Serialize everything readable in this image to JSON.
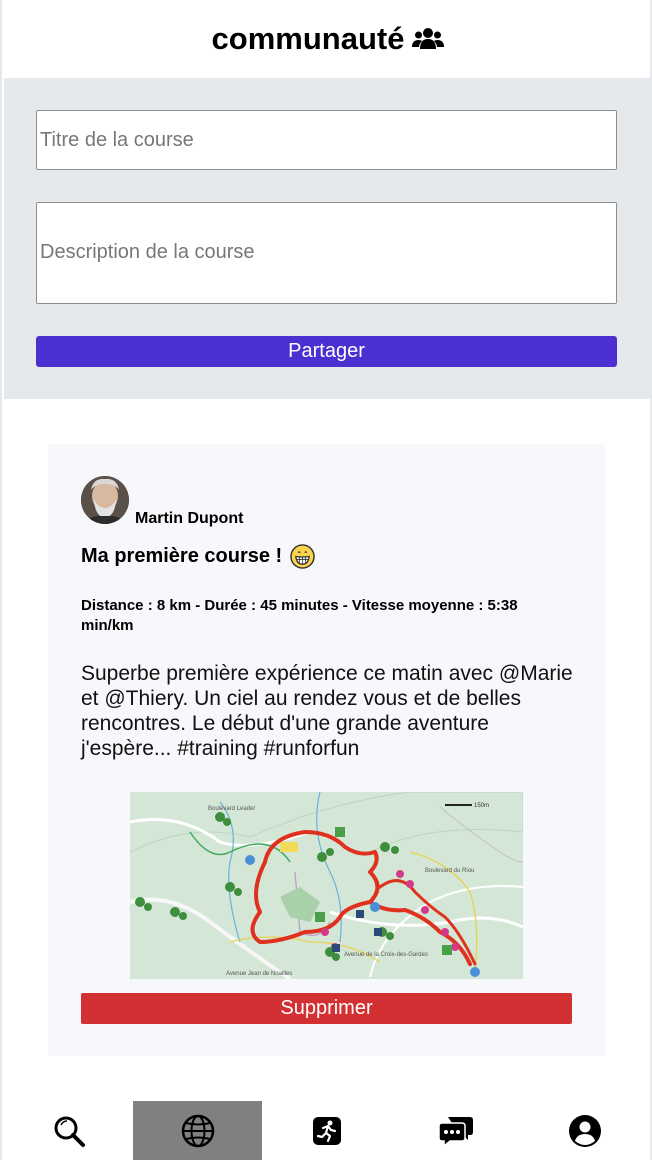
{
  "header": {
    "title": "communauté",
    "icon": "users-icon"
  },
  "composer": {
    "title_placeholder": "Titre de la course",
    "description_placeholder": "Description de la course",
    "share_label": "Partager"
  },
  "post": {
    "author": "Martin Dupont",
    "title": "Ma première course !",
    "title_emoji": "grinning-face-icon",
    "stats": "Distance : 8 km - Durée : 45 minutes - Vitesse moyenne : 5:38 min/km",
    "description": "Superbe première expérience ce matin avec @Marie et @Thiery. Un ciel au rendez vous et de belles rencontres. Le début d'une grande aventure j'espère... #training #runforfun",
    "delete_label": "Supprimer",
    "map": {
      "street_1": "Boulevard Leader",
      "street_2": "Boulevard du Riou",
      "street_3": "Avenue de la Croix-des-Gardes",
      "street_4": "Avenue Jean de Noailles",
      "scale": "150m",
      "route_color": "#e0301e"
    }
  },
  "nav": {
    "items": [
      "search-icon",
      "globe-icon",
      "runner-icon",
      "chat-icon",
      "user-icon"
    ],
    "active_index": 1
  },
  "colors": {
    "accent": "#4c2fd0",
    "danger": "#d33033",
    "composer_bg": "#e6e9ec",
    "card_bg": "#f7f8fb"
  }
}
